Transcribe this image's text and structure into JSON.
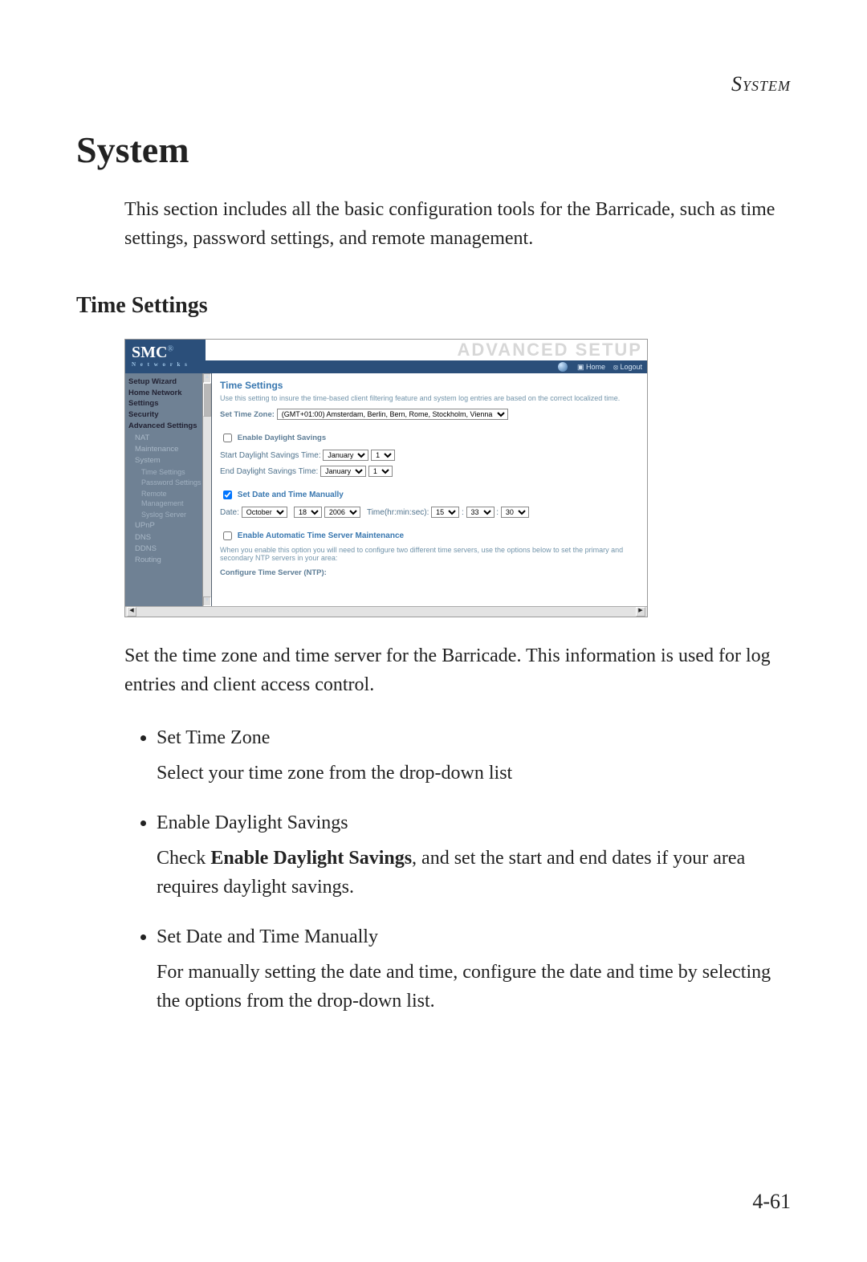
{
  "running_head": "System",
  "h1": "System",
  "intro": "This section includes all the basic configuration tools for the Barricade, such as time settings, password settings, and remote management.",
  "h2": "Time Settings",
  "shot": {
    "logo": "SMC",
    "logo_sub": "N e t w o r k s",
    "big_title": "ADVANCED SETUP",
    "tb_home": "Home",
    "tb_logout": "Logout",
    "sidebar": {
      "setup_wizard": "Setup Wizard",
      "home_network": "Home Network Settings",
      "security": "Security",
      "adv": "Advanced Settings",
      "nat": "NAT",
      "maintenance": "Maintenance",
      "system": "System",
      "time_settings": "Time Settings",
      "password_settings": "Password Settings",
      "remote_mgmt": "Remote Management",
      "syslog_server": "Syslog Server",
      "upnp": "UPnP",
      "dns": "DNS",
      "ddns": "DDNS",
      "routing": "Routing"
    },
    "content": {
      "title": "Time Settings",
      "desc": "Use this setting to insure the time-based client filtering feature and system log entries are based on the correct localized time.",
      "set_tz_label": "Set Time Zone:",
      "tz_value": "(GMT+01:00) Amsterdam, Berlin, Bern, Rome, Stockholm, Vienna",
      "cb_dst": "Enable Daylight Savings",
      "start_dst": "Start Daylight Savings Time:",
      "end_dst": "End Daylight Savings Time:",
      "month_jan": "January",
      "day_1": "1",
      "cb_manual": "Set Date and Time Manually",
      "date_label": "Date:",
      "month_oct": "October",
      "day_18": "18",
      "year_2006": "2006",
      "time_label": "Time(hr:min:sec):",
      "hr": "15",
      "min": "33",
      "sec": "30",
      "cb_auto_ts": "Enable Automatic Time Server Maintenance",
      "auto_desc": "When you enable this option you will need to configure two different time servers, use the options below to set the primary and secondary NTP servers in your area:",
      "configure_ntp": "Configure Time Server (NTP):"
    }
  },
  "after": "Set the time zone and time server for the Barricade. This information is used for log entries and client access control.",
  "bullets": [
    {
      "head": "Set Time Zone",
      "body": "Select your time zone from the drop-down list"
    },
    {
      "head": "Enable Daylight Savings",
      "body_prefix": "Check ",
      "body_bold": "Enable Daylight Savings",
      "body_suffix": ", and set the start and end dates if your area requires daylight savings."
    },
    {
      "head": "Set Date and Time Manually",
      "body": "For manually setting the date and time, configure the date and time by selecting the options from the drop-down list."
    }
  ],
  "page_num": "4-61"
}
